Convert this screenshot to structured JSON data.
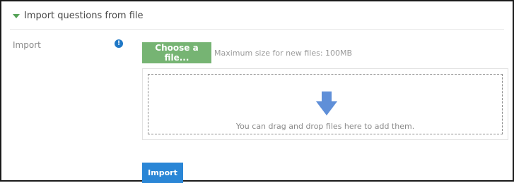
{
  "section": {
    "title": "Import questions from file",
    "expanded_icon": "triangle-down-icon",
    "accent_color": "#54a256"
  },
  "import_field": {
    "label": "Import",
    "help_icon": "info-icon",
    "help_icon_glyph": "!",
    "help_icon_color": "#1f78c6"
  },
  "file_picker": {
    "choose_button_label": "Choose a file...",
    "choose_button_color": "#76b473",
    "max_size_text": "Maximum size for new files: 100MB"
  },
  "dropzone": {
    "icon": "arrow-down-icon",
    "icon_color": "#5f8fd8",
    "text": "You can drag and drop files here to add them."
  },
  "actions": {
    "import_button_label": "Import",
    "import_button_color": "#2a86d6"
  }
}
